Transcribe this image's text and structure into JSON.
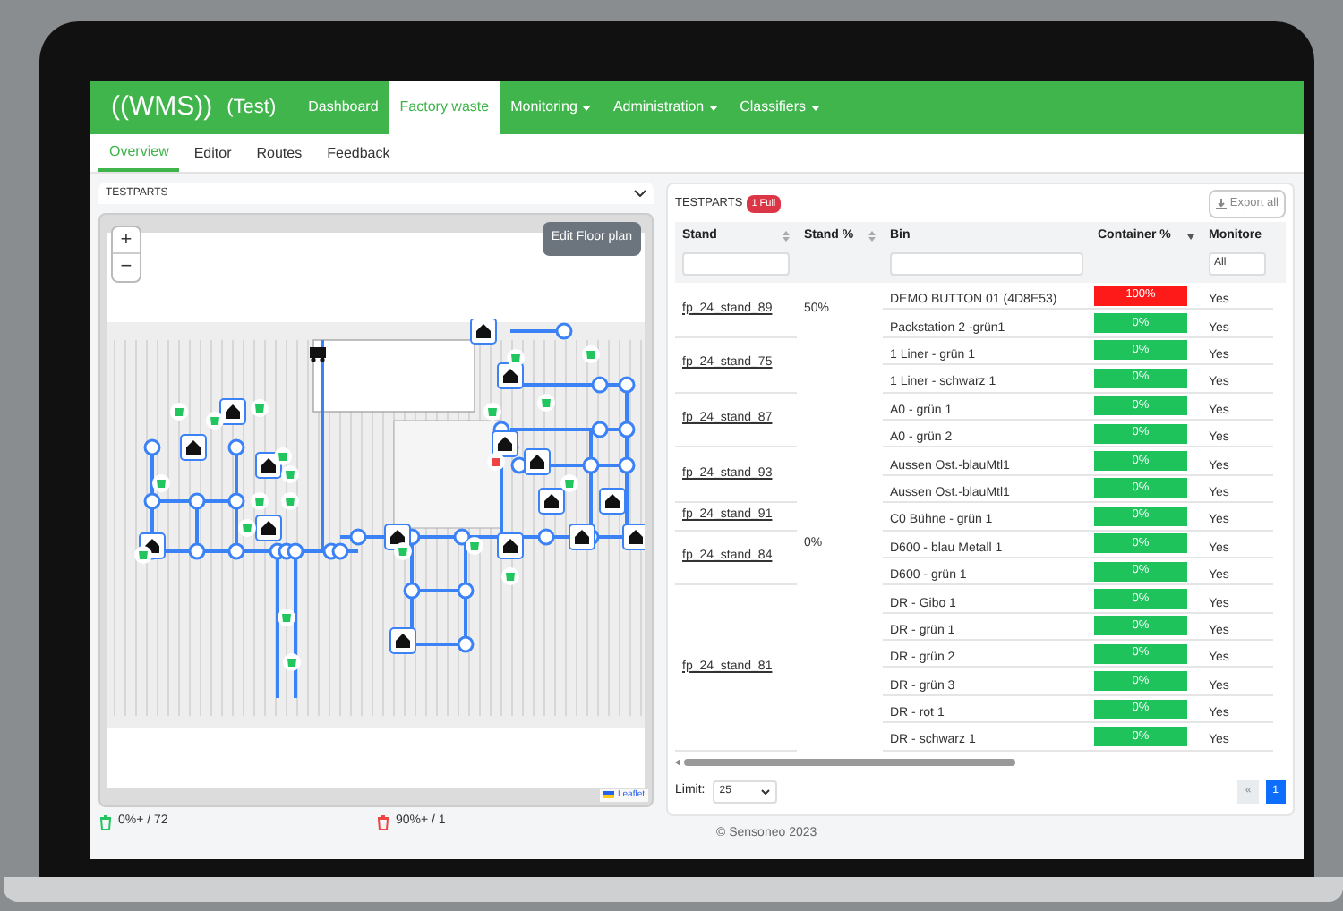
{
  "navbar": {
    "brand": "((WMS))",
    "env": "(Test)",
    "items": [
      {
        "label": "Dashboard",
        "selected": false,
        "dropdown": false
      },
      {
        "label": "Factory waste",
        "selected": true,
        "dropdown": false
      },
      {
        "label": "Monitoring",
        "selected": false,
        "dropdown": true
      },
      {
        "label": "Administration",
        "selected": false,
        "dropdown": true
      },
      {
        "label": "Classifiers",
        "selected": false,
        "dropdown": true
      }
    ]
  },
  "subnav": [
    {
      "label": "Overview",
      "selected": true
    },
    {
      "label": "Editor",
      "selected": false
    },
    {
      "label": "Routes",
      "selected": false
    },
    {
      "label": "Feedback",
      "selected": false
    }
  ],
  "map_panel": {
    "title": "TESTPARTS",
    "edit_button": "Edit Floor plan",
    "zoom_in": "+",
    "zoom_out": "−",
    "attribution": "Leaflet",
    "legend": [
      {
        "text": "0%+ / 72",
        "color": "#22c55e"
      },
      {
        "text": "90%+ / 1",
        "color": "#ef4444"
      }
    ]
  },
  "table_panel": {
    "title": "TESTPARTS",
    "badge": "1 Full",
    "export_button": "Export all",
    "columns": [
      {
        "label": "Stand",
        "sortable": true,
        "sorted_descending": false,
        "kind": "textfilter"
      },
      {
        "label": "Stand %",
        "sortable": true,
        "sorted_descending": false,
        "kind": "plain"
      },
      {
        "label": "Bin",
        "sortable": false,
        "sorted_descending": false,
        "kind": "textfilter"
      },
      {
        "label": "Container %",
        "sortable": false,
        "sorted_descending": true,
        "kind": "plain"
      },
      {
        "label": "Monitore",
        "sortable": false,
        "sorted_descending": false,
        "kind": "select",
        "filter_value": "All"
      }
    ],
    "groups": [
      {
        "stand": "fp_24_stand_89",
        "stand_percent": "50%",
        "bins": [
          {
            "bin": "DEMO BUTTON 01 (4D8E53)",
            "container": "100%",
            "full": true,
            "monitored": "Yes"
          },
          {
            "bin": "Packstation 2 -grün1",
            "container": "0%",
            "full": false,
            "monitored": "Yes"
          }
        ]
      },
      {
        "stand": "fp_24_stand_75",
        "stand_percent": "0%",
        "bins": [
          {
            "bin": "1 Liner - grün 1",
            "container": "0%",
            "full": false,
            "monitored": "Yes"
          },
          {
            "bin": "1 Liner - schwarz 1",
            "container": "0%",
            "full": false,
            "monitored": "Yes"
          }
        ]
      },
      {
        "stand": "fp_24_stand_87",
        "bins": [
          {
            "bin": "A0 - grün 1",
            "container": "0%",
            "full": false,
            "monitored": "Yes"
          },
          {
            "bin": "A0 - grün 2",
            "container": "0%",
            "full": false,
            "monitored": "Yes"
          }
        ]
      },
      {
        "stand": "fp_24_stand_93",
        "bins": [
          {
            "bin": "Aussen Ost.-blauMtl1",
            "container": "0%",
            "full": false,
            "monitored": "Yes"
          },
          {
            "bin": "Aussen Ost.-blauMtl1",
            "container": "0%",
            "full": false,
            "monitored": "Yes"
          }
        ]
      },
      {
        "stand": "fp_24_stand_91",
        "bins": [
          {
            "bin": "C0 Bühne - grün 1",
            "container": "0%",
            "full": false,
            "monitored": "Yes"
          }
        ]
      },
      {
        "stand": "fp_24_stand_84",
        "bins": [
          {
            "bin": "D600 - blau Metall 1",
            "container": "0%",
            "full": false,
            "monitored": "Yes"
          },
          {
            "bin": "D600 - grün 1",
            "container": "0%",
            "full": false,
            "monitored": "Yes"
          }
        ]
      },
      {
        "stand": "fp_24_stand_81",
        "bins": [
          {
            "bin": "DR - Gibo 1",
            "container": "0%",
            "full": false,
            "monitored": "Yes"
          },
          {
            "bin": "DR - grün 1",
            "container": "0%",
            "full": false,
            "monitored": "Yes"
          },
          {
            "bin": "DR - grün 2",
            "container": "0%",
            "full": false,
            "monitored": "Yes"
          },
          {
            "bin": "DR - grün 3",
            "container": "0%",
            "full": false,
            "monitored": "Yes"
          },
          {
            "bin": "DR - rot 1",
            "container": "0%",
            "full": false,
            "monitored": "Yes"
          },
          {
            "bin": "DR - schwarz 1",
            "container": "0%",
            "full": false,
            "monitored": "Yes"
          }
        ]
      }
    ],
    "limit_label": "Limit:",
    "limit_value": "25",
    "pagination": [
      {
        "label": "«",
        "selected": false
      },
      {
        "label": "1",
        "selected": true
      }
    ]
  },
  "footer": "© Sensoneo 2023"
}
